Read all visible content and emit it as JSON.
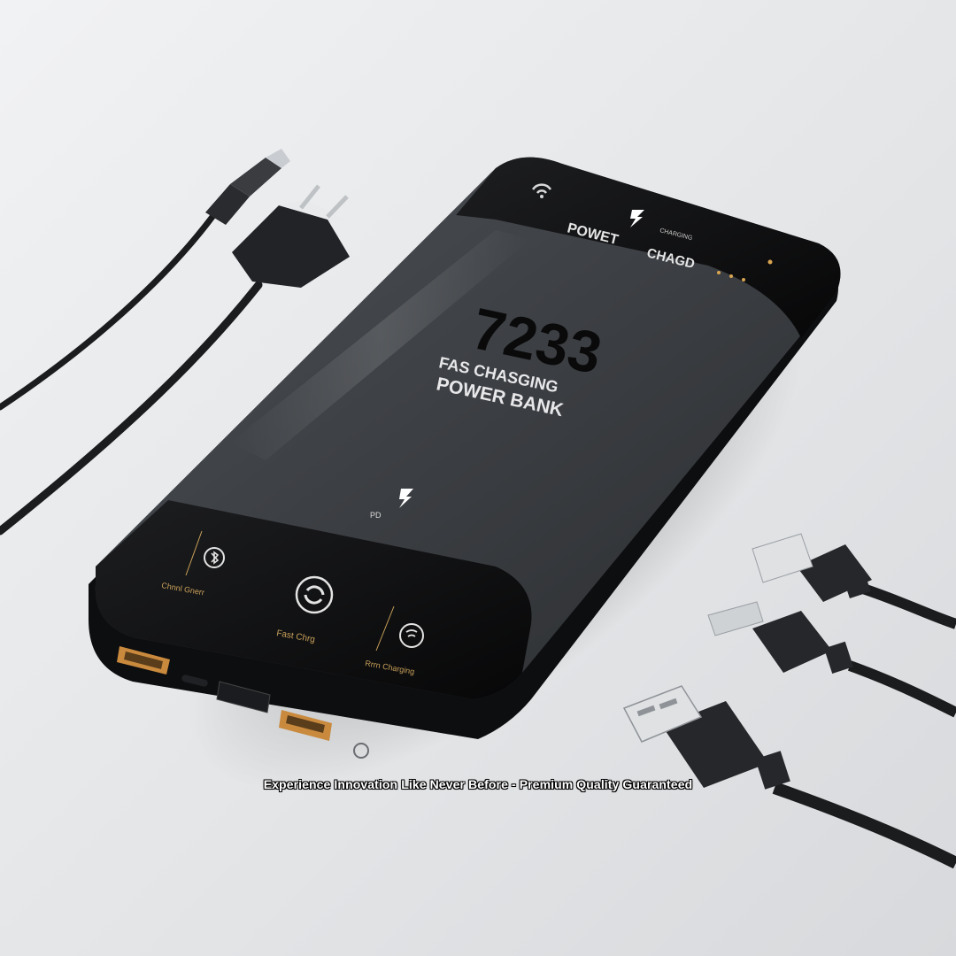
{
  "product": {
    "model_number": "7233",
    "headline_line1": "FAS CHASGING",
    "headline_line2": "POWER BANK",
    "top_label_left": "POWET",
    "top_label_right": "CHAGD",
    "top_small_print": "CHARGING",
    "center_mark_text": "PD",
    "panel_labels": [
      "Chnnl Gnerr",
      "Fast Chrg",
      "Rrrn Charging"
    ]
  },
  "caption": "Experience Innovation Like Never Before - Premium Quality Guaranteed",
  "colors": {
    "background": "#e6e8ea",
    "bank_body": "#3a3d41",
    "bank_dark": "#111214",
    "port_accent": "#c98a3e",
    "caption": "#ffffff"
  },
  "icons": [
    "wireless-icon",
    "lightning-icon",
    "bluetooth-icon",
    "refresh-icon",
    "wireless-charge-icon"
  ]
}
